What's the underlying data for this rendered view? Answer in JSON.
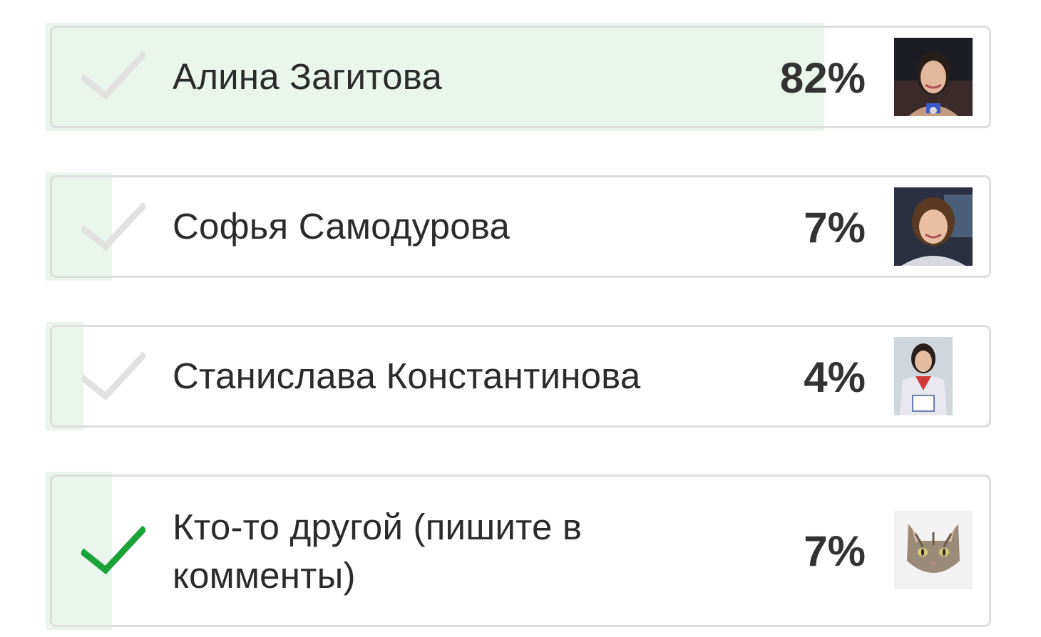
{
  "poll": {
    "options": [
      {
        "label": "Алина Загитова",
        "percent_text": "82%",
        "percent": 82,
        "selected": false,
        "avatar": "person-photo-icon"
      },
      {
        "label": "Софья Самодурова",
        "percent_text": "7%",
        "percent": 7,
        "selected": false,
        "avatar": "person-photo-icon"
      },
      {
        "label": "Станислава Константинова",
        "percent_text": "4%",
        "percent": 4,
        "selected": false,
        "avatar": "person-photo-icon"
      },
      {
        "label": "Кто-то другой (пишите в комменты)",
        "percent_text": "7%",
        "percent": 7,
        "selected": true,
        "avatar": "cat-photo-icon"
      }
    ]
  },
  "colors": {
    "fill": "#eaf6ec",
    "border": "#dedede",
    "check_selected": "#1aa33a",
    "check_unselected": "#e1e1e1",
    "text": "#2b2b2b",
    "percent": "#333333"
  }
}
